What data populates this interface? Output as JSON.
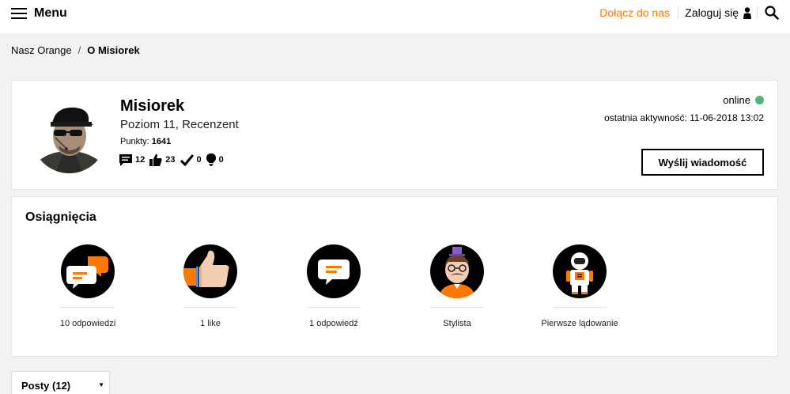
{
  "header": {
    "menu_label": "Menu",
    "join_label": "Dołącz do nas",
    "login_label": "Zaloguj się"
  },
  "breadcrumb": {
    "root": "Nasz Orange",
    "separator": "/",
    "current": "O Misiorek"
  },
  "profile": {
    "name": "Misiorek",
    "level": "Poziom 11, Recenzent",
    "points_label": "Punkty:",
    "points_value": "1641",
    "stats": {
      "messages": "12",
      "likes": "23",
      "solutions": "0",
      "ideas": "0"
    },
    "status": "online",
    "last_activity": "ostatnia aktywność: 11-06-2018 13:02",
    "send_message_label": "Wyślij wiadomość"
  },
  "achievements": {
    "title": "Osiągnięcia",
    "items": [
      {
        "label": "10 odpowiedzi",
        "icon": "speech-bubbles-icon"
      },
      {
        "label": "1 like",
        "icon": "thumbs-up-icon"
      },
      {
        "label": "1 odpowiedź",
        "icon": "speech-bubble-icon"
      },
      {
        "label": "Stylista",
        "icon": "stylist-icon"
      },
      {
        "label": "Pierwsze lądowanie",
        "icon": "astronaut-icon"
      }
    ]
  },
  "posts_select": {
    "value": "Posty (12)"
  },
  "colors": {
    "accent": "#ff7900",
    "online": "#4bb875"
  }
}
